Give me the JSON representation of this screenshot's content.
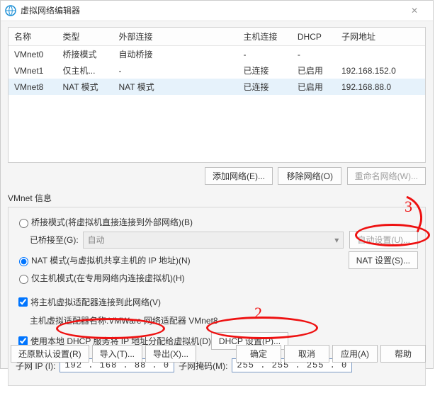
{
  "titlebar": {
    "title": "虚拟网络编辑器"
  },
  "table": {
    "headers": {
      "name": "名称",
      "type": "类型",
      "ext": "外部连接",
      "host": "主机连接",
      "dhcp": "DHCP",
      "subnet": "子网地址"
    },
    "rows": [
      {
        "name": "VMnet0",
        "type": "桥接模式",
        "ext": "自动桥接",
        "host": "-",
        "dhcp": "-",
        "subnet": ""
      },
      {
        "name": "VMnet1",
        "type": "仅主机...",
        "ext": "-",
        "host": "已连接",
        "dhcp": "已启用",
        "subnet": "192.168.152.0"
      },
      {
        "name": "VMnet8",
        "type": "NAT 模式",
        "ext": "NAT 模式",
        "host": "已连接",
        "dhcp": "已启用",
        "subnet": "192.168.88.0",
        "selected": true
      }
    ]
  },
  "netbtns": {
    "add": "添加网络(E)...",
    "remove": "移除网络(O)",
    "rename": "重命名网络(W)..."
  },
  "group_title": "VMnet 信息",
  "modes": {
    "bridge": "桥接模式(将虚拟机直接连接到外部网络)(B)",
    "bridge_to": "已桥接至(G):",
    "bridge_sel": "自动",
    "bridge_btn": "自动设置(U)...",
    "nat": "NAT 模式(与虚拟机共享主机的 IP 地址)(N)",
    "nat_btn": "NAT 设置(S)...",
    "hostonly": "仅主机模式(在专用网络内连接虚拟机)(H)"
  },
  "host": {
    "connect": "将主机虚拟适配器连接到此网络(V)",
    "adapter_lbl": "主机虚拟适配器名称: ",
    "adapter_val": "VMWare 网络适配器 VMnet8",
    "dhcp": "使用本地 DHCP 服务将 IP 地址分配给虚拟机(D)",
    "dhcp_btn": "DHCP 设置(P)..."
  },
  "subnet": {
    "ip_lbl": "子网 IP (I):",
    "ip_val": "192 . 168 . 88  .  0",
    "mask_lbl": "子网掩码(M):",
    "mask_val": "255 . 255 . 255 .  0"
  },
  "footer": {
    "restore": "还原默认设置(R)",
    "import": "导入(T)...",
    "export": "导出(X)...",
    "ok": "确定",
    "cancel": "取消",
    "apply": "应用(A)",
    "help": "帮助"
  },
  "annotations": {
    "num2": "2",
    "num3": "3"
  }
}
